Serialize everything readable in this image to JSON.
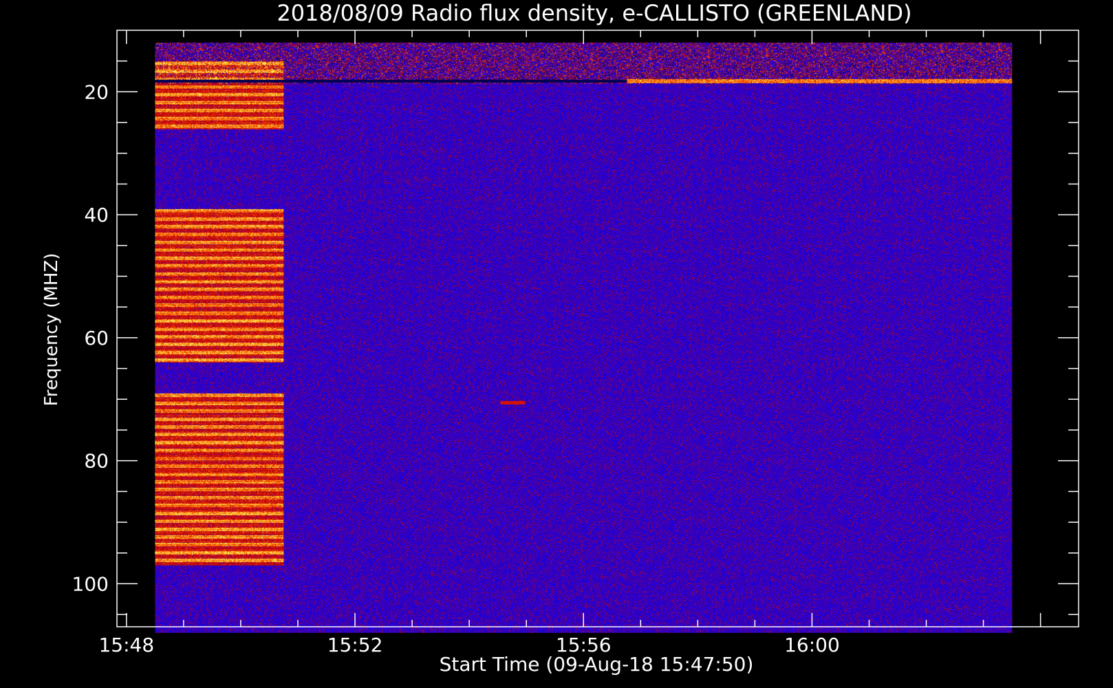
{
  "chart_data": {
    "type": "heatmap",
    "title": "2018/08/09  Radio flux density, e-CALLISTO (GREENLAND)",
    "xlabel": "Start Time (09-Aug-18 15:47:50)",
    "ylabel": "Frequency (MHZ)",
    "x_range": [
      "15:47:50",
      "16:04:40"
    ],
    "y_range_mhz": [
      10,
      107
    ],
    "y_axis_inverted": true,
    "data_time_range": [
      "15:48:30",
      "16:03:30"
    ],
    "data_freq_range_mhz": [
      12,
      108
    ],
    "x_ticks": [
      "15:48",
      "15:52",
      "15:56",
      "16:00"
    ],
    "y_ticks": [
      20,
      40,
      60,
      80,
      100
    ],
    "colormap": [
      "#000000",
      "#0000ff",
      "#cc0000",
      "#ff6600",
      "#ffee55"
    ],
    "background_level": "low (blue)",
    "features": [
      {
        "name": "intense band block",
        "time_start": "15:48:30",
        "time_end": "15:50:45",
        "freq_bands_mhz": [
          [
            15,
            26
          ],
          [
            39,
            64
          ],
          [
            69,
            97
          ]
        ]
      },
      {
        "name": "narrowband emission line",
        "time_start": "15:56:45",
        "time_end": "16:03:30",
        "freq_mhz": 18.2
      },
      {
        "name": "short burst",
        "time": "15:54:45",
        "freq_mhz": 70.5
      }
    ],
    "grid": false,
    "legend": "none"
  }
}
